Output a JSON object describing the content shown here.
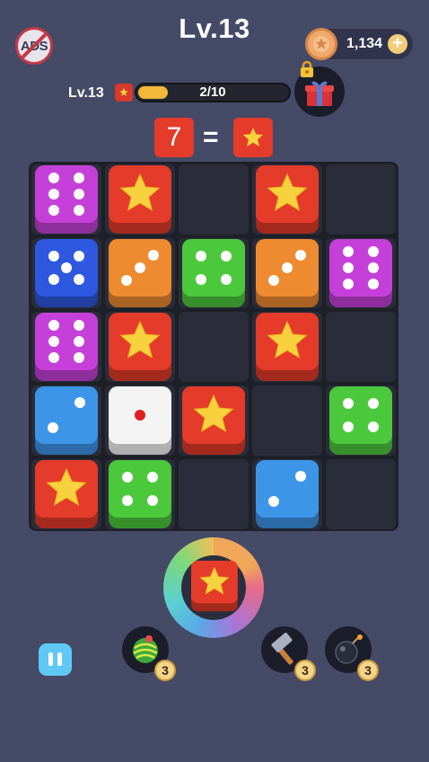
{
  "header": {
    "ads_label": "ADS",
    "level_title": "Lv.13",
    "coins": "1,134",
    "coin_add": "+"
  },
  "progress": {
    "level_label": "Lv.13",
    "text": "2/10",
    "fraction": 0.2
  },
  "equation": {
    "number": "7",
    "equals": "=",
    "result_icon": "star-icon"
  },
  "board": {
    "rows": 5,
    "cols": 5,
    "cells": [
      [
        {
          "kind": "die",
          "value": 6,
          "color": "#c540d8"
        },
        {
          "kind": "star"
        },
        {
          "kind": "empty"
        },
        {
          "kind": "star"
        },
        {
          "kind": "empty"
        }
      ],
      [
        {
          "kind": "die",
          "value": 5,
          "color": "#2e58e0"
        },
        {
          "kind": "die",
          "value": 3,
          "color": "#ee8a30"
        },
        {
          "kind": "die",
          "value": 4,
          "color": "#4cc83c"
        },
        {
          "kind": "die",
          "value": 3,
          "color": "#ee8a30"
        },
        {
          "kind": "die",
          "value": 6,
          "color": "#c540d8"
        }
      ],
      [
        {
          "kind": "die",
          "value": 6,
          "color": "#c540d8"
        },
        {
          "kind": "star"
        },
        {
          "kind": "empty"
        },
        {
          "kind": "star"
        },
        {
          "kind": "empty"
        }
      ],
      [
        {
          "kind": "die",
          "value": 2,
          "color": "#3d95e8"
        },
        {
          "kind": "die",
          "value": 1,
          "color": "#f4f4f4"
        },
        {
          "kind": "star"
        },
        {
          "kind": "empty"
        },
        {
          "kind": "die",
          "value": 4,
          "color": "#4cc83c"
        }
      ],
      [
        {
          "kind": "star"
        },
        {
          "kind": "die",
          "value": 4,
          "color": "#4cc83c"
        },
        {
          "kind": "empty"
        },
        {
          "kind": "die",
          "value": 2,
          "color": "#3d95e8"
        },
        {
          "kind": "empty"
        }
      ]
    ]
  },
  "next_piece": {
    "kind": "star"
  },
  "tools": [
    {
      "name": "shuffle-tool",
      "icon": "swirl-ball-icon",
      "count": "3"
    },
    {
      "name": "hammer-tool",
      "icon": "hammer-icon",
      "count": "3"
    },
    {
      "name": "bomb-tool",
      "icon": "bomb-icon",
      "count": "3"
    }
  ],
  "colors": {
    "background": "#454a67",
    "star_tile": "#e53b2a",
    "star": "#f7d23e",
    "progress_fill": "#f2b83a"
  }
}
